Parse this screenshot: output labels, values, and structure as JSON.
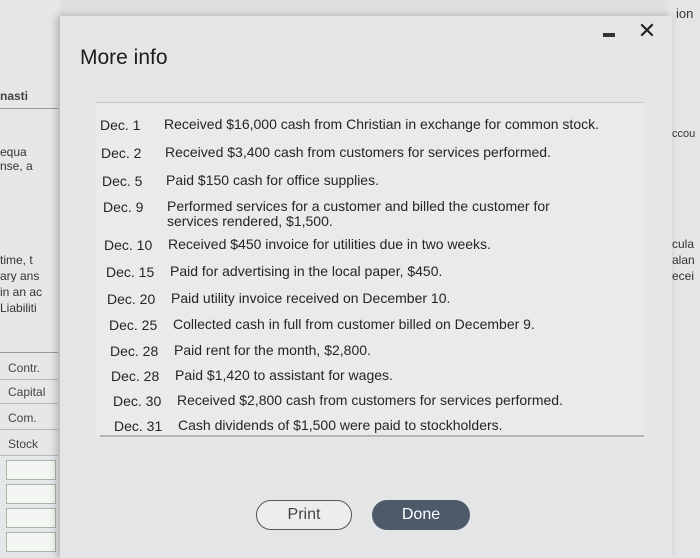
{
  "modal": {
    "title": "More info",
    "close_glyph": "✕",
    "print_label": "Print",
    "done_label": "Done"
  },
  "transactions": [
    {
      "date": "Dec. 1",
      "desc": "Received $16,000 cash from Christian in exchange for common stock."
    },
    {
      "date": "Dec. 2",
      "desc": "Received $3,400 cash from customers for services performed."
    },
    {
      "date": "Dec. 5",
      "desc": "Paid $150 cash for office supplies."
    },
    {
      "date": "Dec. 9",
      "desc": "Performed services for a customer and billed the customer for services rendered, $1,500."
    },
    {
      "date": "Dec. 10",
      "desc": "Received $450 invoice for utilities due in two weeks."
    },
    {
      "date": "Dec. 15",
      "desc": "Paid for advertising in the local paper, $450."
    },
    {
      "date": "Dec. 20",
      "desc": "Paid utility invoice received on December 10."
    },
    {
      "date": "Dec. 25",
      "desc": "Collected cash in full from customer billed on December 9."
    },
    {
      "date": "Dec. 28",
      "desc": "Paid rent for the month, $2,800."
    },
    {
      "date": "Dec. 28",
      "desc": "Paid $1,420 to assistant for wages."
    },
    {
      "date": "Dec. 30",
      "desc": "Received $2,800 cash from customers for services performed."
    },
    {
      "date": "Dec. 31",
      "desc": "Cash dividends of $1,500 were paid to stockholders."
    }
  ],
  "background": {
    "frag_top_right": "ion",
    "frag_left_1": "nasti",
    "frag_left_2": "equa",
    "frag_left_3": "nse, a",
    "frag_left_4": "time, t",
    "frag_left_5": "ary ans",
    "frag_left_6": "in an ac",
    "frag_left_7": "Liabiliti",
    "left_box_1": "Contr.",
    "left_box_2": "Capital",
    "left_box_3": "Com.",
    "left_box_4": "Stock",
    "frag_right_1": "ccou",
    "frag_right_2": "cula",
    "frag_right_3": "alan",
    "frag_right_4": "ecei"
  }
}
